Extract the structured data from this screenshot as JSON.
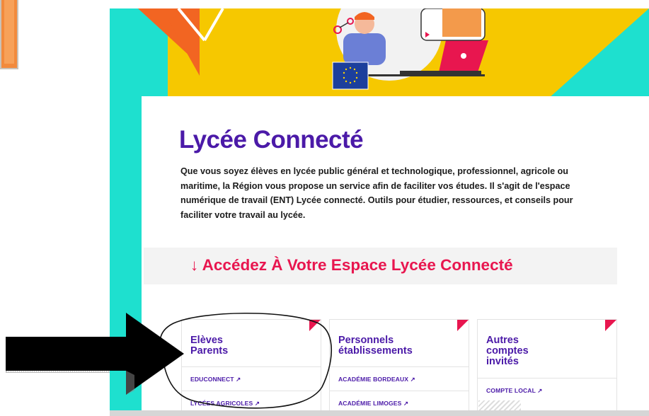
{
  "page": {
    "title": "Lycée Connecté",
    "intro": "Que vous soyez élèves en lycée public général et technologique, professionnel, agricole ou maritime, la Région vous propose un service afin de faciliter vos études. Il s'agit de l'espace numérique de travail (ENT) Lycée connecté. Outils pour étudier, ressources, et conseils pour faciliter votre travail au lycée.",
    "access_heading": "↓ Accédez À Votre Espace Lycée Connecté"
  },
  "cards": [
    {
      "title_line1": "Elèves",
      "title_line2": "Parents",
      "links": [
        "EDUCONNECT ↗",
        "LYCÉES AGRICOLES ↗"
      ]
    },
    {
      "title_line1": "Personnels",
      "title_line2": "établissements",
      "links": [
        "ACADÉMIE BORDEAUX ↗",
        "ACADÉMIE LIMOGES ↗"
      ]
    },
    {
      "title_line1": "Autres",
      "title_line2": "comptes",
      "title_line3": "invités",
      "links": [
        "COMPTE LOCAL ↗"
      ]
    }
  ],
  "colors": {
    "primary_purple": "#4b1aa8",
    "accent_red": "#e8164f",
    "hero_yellow": "#f6c800",
    "teal": "#1ee0cf",
    "orange": "#f26522"
  },
  "icons": [
    "eu-flag-icon",
    "arrow-annotation-icon"
  ]
}
